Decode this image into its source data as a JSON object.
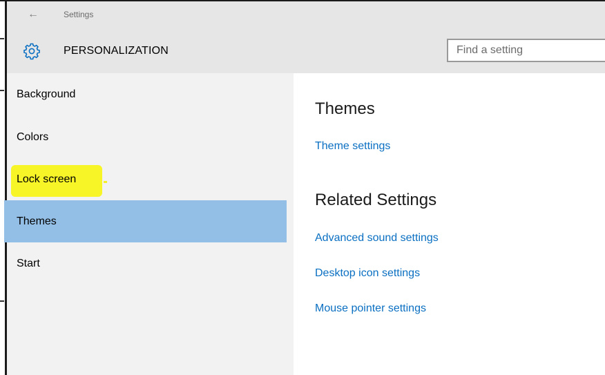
{
  "window": {
    "title": "Settings",
    "back_glyph": "←"
  },
  "header": {
    "icon": "gear-icon",
    "title": "PERSONALIZATION",
    "search_placeholder": "Find a setting"
  },
  "sidebar": {
    "selected": "Themes",
    "highlight_color": "#f7f41c",
    "selected_color": "#93bfe6",
    "items": [
      {
        "label": "Background"
      },
      {
        "label": "Colors"
      },
      {
        "label": "Lock screen"
      },
      {
        "label": "Themes"
      },
      {
        "label": "Start"
      }
    ]
  },
  "content": {
    "themes_heading": "Themes",
    "theme_settings_link": "Theme settings",
    "related_heading": "Related Settings",
    "links": [
      "Advanced sound settings",
      "Desktop icon settings",
      "Mouse pointer settings"
    ],
    "link_color": "#0a6fc2"
  }
}
